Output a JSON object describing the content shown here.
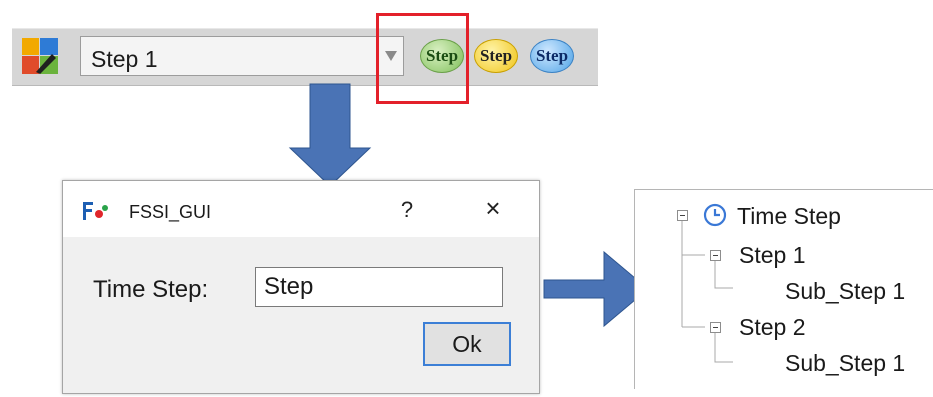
{
  "toolbar": {
    "step_selector_value": "Step 1",
    "step_buttons": [
      {
        "label": "Step",
        "color": "#7fbf5a"
      },
      {
        "label": "Step",
        "color": "#f0c419"
      },
      {
        "label": "Step",
        "color": "#4fa3e6"
      }
    ],
    "highlight_color": "#e3202a"
  },
  "dialog": {
    "title": "FSSI_GUI",
    "help_label": "?",
    "close_label": "×",
    "field_label": "Time Step:",
    "field_value": "Step",
    "ok_label": "Ok"
  },
  "tree": {
    "root": "Time Step",
    "items": [
      {
        "label": "Step 1",
        "child": "Sub_Step 1"
      },
      {
        "label": "Step 2",
        "child": "Sub_Step 1"
      }
    ]
  },
  "accent_arrow_color": "#4a73b5"
}
